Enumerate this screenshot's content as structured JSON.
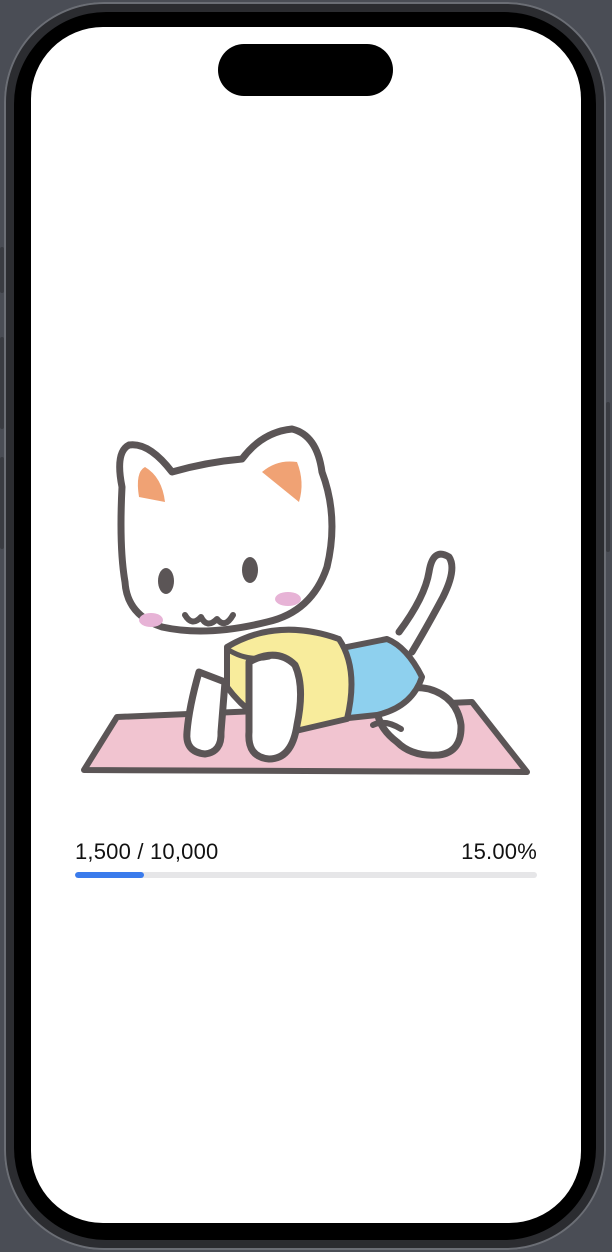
{
  "progress": {
    "current": "1,500",
    "separator": " / ",
    "goal": "10,000",
    "count_label": "1,500 / 10,000",
    "percent_label": "15.00%",
    "fraction": 0.15,
    "fill_color": "#3a7bec",
    "track_color": "#e6e6e8"
  },
  "illustration": {
    "icon": "cat-exercising-illustration"
  }
}
